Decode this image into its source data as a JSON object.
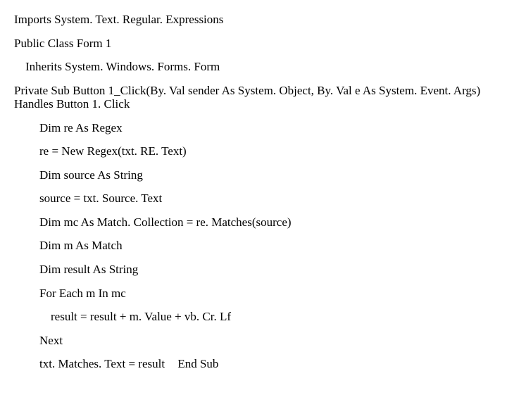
{
  "code": {
    "l1": "Imports System. Text. Regular. Expressions",
    "l2": "Public Class Form 1",
    "l3": "Inherits System. Windows. Forms. Form",
    "l4": "Private Sub Button 1_Click(By. Val sender As System. Object, By. Val e As System. Event. Args) Handles Button 1. Click",
    "l5": "Dim re As Regex",
    "l6": "re = New Regex(txt. RE. Text)",
    "l7": "Dim source As String",
    "l8": "source = txt. Source. Text",
    "l9": "Dim mc As Match. Collection = re. Matches(source)",
    "l10": "Dim m As Match",
    "l11": "Dim result As String",
    "l12": "For Each m In mc",
    "l13": "result = result + m. Value + vb. Cr. Lf",
    "l14": "Next",
    "l15a": "txt. Matches. Text = result",
    "l15b": "End Sub"
  }
}
